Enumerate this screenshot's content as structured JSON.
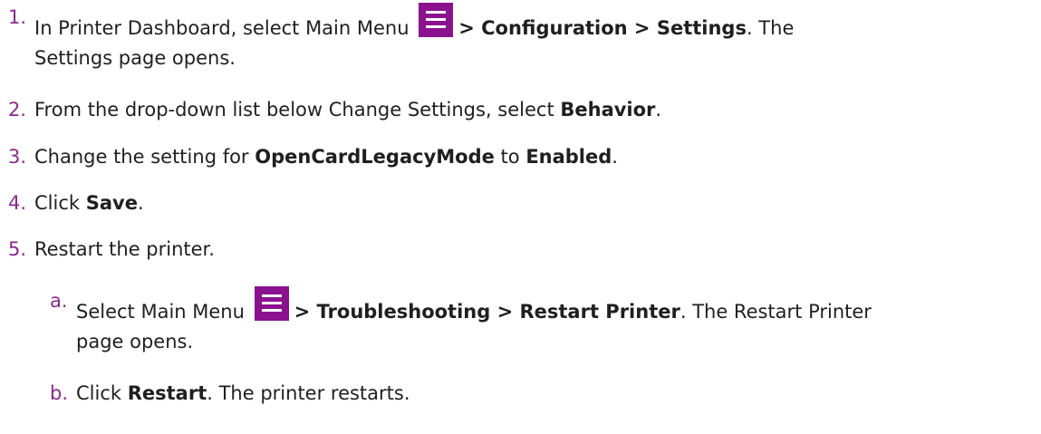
{
  "steps": [
    {
      "num": "1.",
      "t1": "In Printer Dashboard, select Main Menu ",
      "icon": "hamburger-menu-icon",
      "b1": "> Configuration > Settings",
      "t2": ". The",
      "line2": "Settings page opens."
    },
    {
      "num": "2.",
      "t1": "From the drop-down list below Change Settings, select ",
      "b1": "Behavior",
      "t2": "."
    },
    {
      "num": "3.",
      "t1": "Change the setting for ",
      "b1": "OpenCardLegacyMode",
      "t2": " to ",
      "b2": "Enabled",
      "t3": "."
    },
    {
      "num": "4.",
      "t1": "Click ",
      "b1": "Save",
      "t2": "."
    },
    {
      "num": "5.",
      "t1": "Restart the printer."
    }
  ],
  "substeps": [
    {
      "num": "a.",
      "t1": "Select Main Menu ",
      "icon": "hamburger-menu-icon",
      "b1": "> Troubleshooting > Restart Printer",
      "t2": ". The Restart Printer",
      "line2": "page opens."
    },
    {
      "num": "b.",
      "t1": "Click ",
      "b1": "Restart",
      "t2": ". The printer restarts."
    }
  ],
  "colors": {
    "accent": "#8a128f",
    "number": "#8a2a8e",
    "text": "#1f1f1f"
  }
}
